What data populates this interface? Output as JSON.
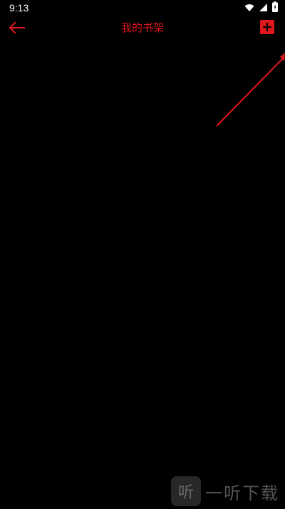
{
  "status_bar": {
    "time": "9:13",
    "icons": [
      "wifi-icon",
      "signal-icon",
      "battery-icon"
    ]
  },
  "app_bar": {
    "title": "我的书架",
    "back_icon": "arrow-left-icon",
    "add_icon": "plus-icon"
  },
  "watermark": {
    "logo_char": "听",
    "text": "一听下载"
  },
  "colors": {
    "accent": "#e0181d",
    "background": "#000000",
    "status_text": "#ffffff"
  }
}
